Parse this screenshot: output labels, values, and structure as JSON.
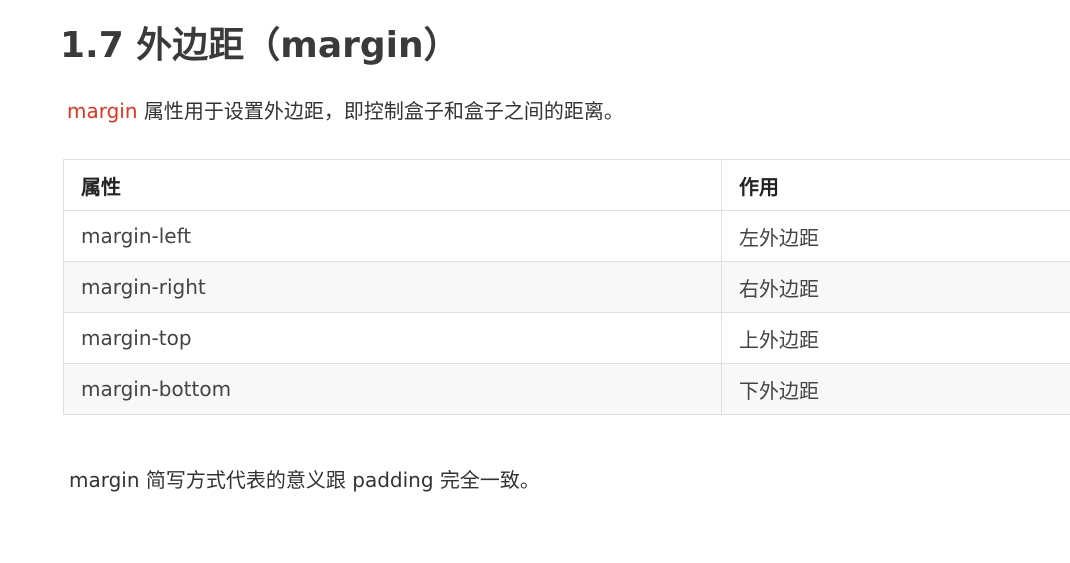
{
  "heading": "1.7 外边距（margin）",
  "intro": {
    "keyword": "margin",
    "text": " 属性用于设置外边距，即控制盒子和盒子之间的距离。"
  },
  "table": {
    "headers": [
      "属性",
      "作用"
    ],
    "rows": [
      [
        "margin-left",
        "左外边距"
      ],
      [
        "margin-right",
        "右外边距"
      ],
      [
        "margin-top",
        "上外边距"
      ],
      [
        "margin-bottom",
        "下外边距"
      ]
    ]
  },
  "outro": "margin 简写方式代表的意义跟 padding 完全一致。",
  "colors": {
    "keyword": "#e8321e",
    "heading": "#3a3a3a",
    "border": "#dfdfdf",
    "row_shade": "#f8f8f8"
  }
}
